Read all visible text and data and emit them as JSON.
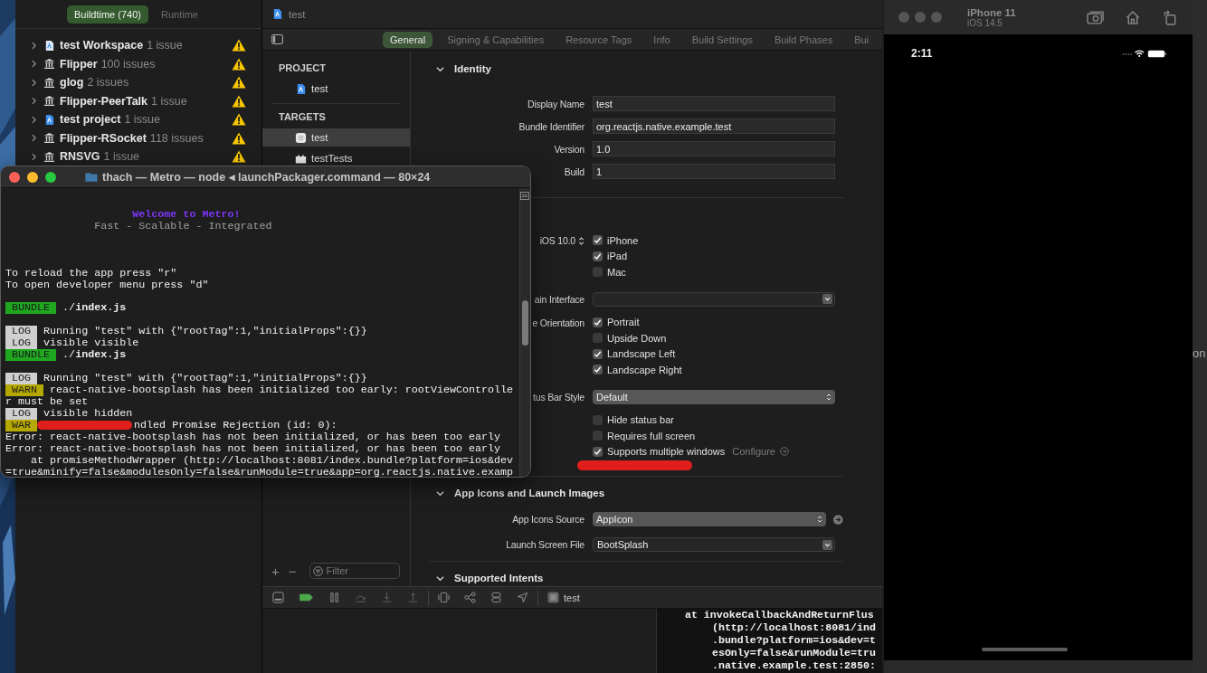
{
  "navigator": {
    "segments": [
      {
        "label": "Buildtime (740)",
        "selected": true
      },
      {
        "label": "Runtime",
        "selected": false
      }
    ],
    "items": [
      {
        "kind": "workspace",
        "name": "test Workspace",
        "count": "1 issue"
      },
      {
        "kind": "package",
        "name": "Flipper",
        "count": "100 issues"
      },
      {
        "kind": "package",
        "name": "glog",
        "count": "2 issues"
      },
      {
        "kind": "package",
        "name": "Flipper-PeerTalk",
        "count": "1 issue"
      },
      {
        "kind": "project",
        "name": "test project",
        "count": "1 issue"
      },
      {
        "kind": "package",
        "name": "Flipper-RSocket",
        "count": "118 issues"
      },
      {
        "kind": "package",
        "name": "RNSVG",
        "count": "1 issue"
      }
    ]
  },
  "editor": {
    "path": "test",
    "tabs": [
      {
        "label": "General",
        "selected": true
      },
      {
        "label": "Signing & Capabilities",
        "selected": false
      },
      {
        "label": "Resource Tags",
        "selected": false
      },
      {
        "label": "Info",
        "selected": false
      },
      {
        "label": "Build Settings",
        "selected": false
      },
      {
        "label": "Build Phases",
        "selected": false
      },
      {
        "label": "Bui",
        "selected": false
      }
    ],
    "project_header": "PROJECT",
    "projects": [
      {
        "kind": "project",
        "name": "test",
        "selected": false
      }
    ],
    "targets_header": "TARGETS",
    "targets": [
      {
        "kind": "app",
        "name": "test",
        "selected": true
      },
      {
        "kind": "bundle",
        "name": "testTests",
        "selected": false
      }
    ],
    "add_label": "+",
    "remove_label": "−",
    "filter_placeholder": "Filter",
    "settings": [
      {
        "kind": "section",
        "title": "Identity",
        "expanded": true
      },
      {
        "kind": "text_field",
        "label": "Display Name",
        "value": "test"
      },
      {
        "kind": "text_field",
        "label": "Bundle Identifier",
        "value": "org.reactjs.native.example.test"
      },
      {
        "kind": "text_field",
        "label": "Version",
        "value": "1.0"
      },
      {
        "kind": "text_field",
        "label": "Build",
        "value": "1"
      },
      {
        "kind": "divider"
      },
      {
        "kind": "checks",
        "label": "iOS 10.0",
        "stepper": true,
        "options": [
          {
            "label": "iPhone",
            "checked": true
          },
          {
            "label": "iPad",
            "checked": true
          },
          {
            "label": "Mac",
            "checked": false
          }
        ]
      },
      {
        "kind": "popup",
        "label": "ain Interface"
      },
      {
        "kind": "checks",
        "label": "e Orientation",
        "options": [
          {
            "label": "Portrait",
            "checked": true
          },
          {
            "label": "Upside Down",
            "checked": false
          },
          {
            "label": "Landscape Left",
            "checked": true
          },
          {
            "label": "Landscape Right",
            "checked": true
          }
        ]
      },
      {
        "kind": "select",
        "label": "tus Bar Style",
        "value": "Default"
      },
      {
        "kind": "checks",
        "options": [
          {
            "label": "Hide status bar",
            "checked": false
          },
          {
            "label": "Requires full screen",
            "checked": false
          },
          {
            "label": "Supports multiple windows",
            "checked": true,
            "link": "Configure",
            "redacted": true
          }
        ]
      },
      {
        "kind": "section",
        "title": "App Icons and Launch Images",
        "expanded": true
      },
      {
        "kind": "select",
        "label": "App Icons Source",
        "value": "AppIcon",
        "go_arrow": true
      },
      {
        "kind": "popup",
        "label": "Launch Screen File",
        "value": "BootSplash"
      },
      {
        "kind": "section",
        "title": "Supported Intents",
        "expanded": true
      }
    ],
    "scheme": "test",
    "console_lines": [
      {
        "text": "at invokeCallbackAndReturnFlus",
        "indented": false
      },
      {
        "text": "(http://localhost:8081/ind",
        "indented": true
      },
      {
        "text": ".bundle?platform=ios&dev=t",
        "indented": true
      },
      {
        "text": "esOnly=false&runModule=tru",
        "indented": true
      },
      {
        "text": ".native.example.test:2850:",
        "indented": true
      }
    ]
  },
  "terminal": {
    "title": "thach — Metro — node ◂ launchPackager.command — 80×24",
    "lines": [
      {
        "kind": "blank"
      },
      {
        "kind": "banner_title",
        "text": "Welcome to Metro!"
      },
      {
        "kind": "banner_subtitle",
        "text": "Fast - Scalable - Integrated"
      },
      {
        "kind": "blank"
      },
      {
        "kind": "blank"
      },
      {
        "kind": "blank"
      },
      {
        "kind": "text",
        "text": "To reload the app press \"r\""
      },
      {
        "kind": "text",
        "text": "To open developer menu press \"d\""
      },
      {
        "kind": "blank"
      },
      {
        "kind": "text",
        "badge": {
          "kind": "bundle",
          "label": "BUNDLE"
        },
        "text": "./**index.js**"
      },
      {
        "kind": "blank"
      },
      {
        "kind": "text",
        "badge": {
          "kind": "log",
          "label": "LOG"
        },
        "text": "Running \"test\" with {\"rootTag\":1,\"initialProps\":{}}"
      },
      {
        "kind": "text",
        "badge": {
          "kind": "log",
          "label": "LOG"
        },
        "text": "visible visible"
      },
      {
        "kind": "text",
        "badge": {
          "kind": "bundle",
          "label": "BUNDLE"
        },
        "text": "./**index.js**"
      },
      {
        "kind": "blank"
      },
      {
        "kind": "text",
        "badge": {
          "kind": "log",
          "label": "LOG"
        },
        "text": "Running \"test\" with {\"rootTag\":1,\"initialProps\":{}}"
      },
      {
        "kind": "text",
        "badge": {
          "kind": "warn",
          "label": "WARN"
        },
        "text": "react-native-bootsplash has been initialized too early: rootViewControlle"
      },
      {
        "kind": "text",
        "text": "r must be set"
      },
      {
        "kind": "text",
        "badge": {
          "kind": "log",
          "label": "LOG"
        },
        "text": "visible hidden"
      },
      {
        "kind": "text",
        "badge": {
          "kind": "warn",
          "label": "WAR"
        },
        "redacted": true,
        "text": "ndled Promise Rejection (id: 0):"
      },
      {
        "kind": "text",
        "text": "Error: react-native-bootsplash has not been initialized, or has been too early"
      },
      {
        "kind": "text",
        "text": "Error: react-native-bootsplash has not been initialized, or has been too early"
      },
      {
        "kind": "text",
        "indented": true,
        "text": "at promiseMethodWrapper (http://localhost:8081/index.bundle?platform=ios&dev"
      },
      {
        "kind": "text",
        "text": "=true&minify=false&modulesOnly=false&runModule=true&app=org.reactjs.native.examp"
      }
    ]
  },
  "simulator": {
    "device": "iPhone 11",
    "os": "iOS 14.5",
    "time": "2:11"
  },
  "edge_text": "on"
}
